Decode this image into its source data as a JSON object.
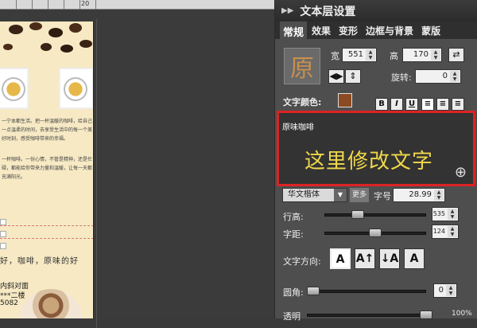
{
  "canvas": {
    "ruler_label": "20",
    "doc_paragraph_1": "一宁本都生活。把一杯温暖的咖啡，给自己一点温柔的时间，去享受生活中的每一个美好时刻，感受咖啡带来的幸福。",
    "doc_paragraph_2": "一杯咖啡。一份心情，不管是精神，还是忙碌，都能给你带来力量和温暖，让每一天都充满阳光。",
    "tagline": "好，咖啡，原味的好",
    "address_1": "内斜对面",
    "address_2": "***二楼",
    "phone": "5082"
  },
  "panel": {
    "title": "文本层设置",
    "tabs": [
      "常规",
      "效果",
      "变形",
      "边框与背景",
      "蒙版"
    ],
    "preview_char": "原",
    "width_label": "宽",
    "width_value": "551",
    "height_label": "高",
    "height_value": "170",
    "rotate_label": "旋转:",
    "rotate_value": "0",
    "text_color_label": "文字颜色:",
    "text_color": "#8b4a22",
    "format_buttons": [
      "B",
      "I",
      "U"
    ],
    "text_small": "原味咖啡",
    "text_big": "这里修改文字",
    "font_name": "华文楷体",
    "more_label": "更多",
    "font_size_label": "字号",
    "font_size_value": "28.99",
    "line_height_label": "行高:",
    "line_height_value": "535",
    "letter_spacing_label": "字距:",
    "letter_spacing_value": "124",
    "direction_label": "文字方向:",
    "corner_label": "圆角:",
    "corner_value": "0",
    "opacity_label": "透明",
    "opacity_value": "100%"
  }
}
